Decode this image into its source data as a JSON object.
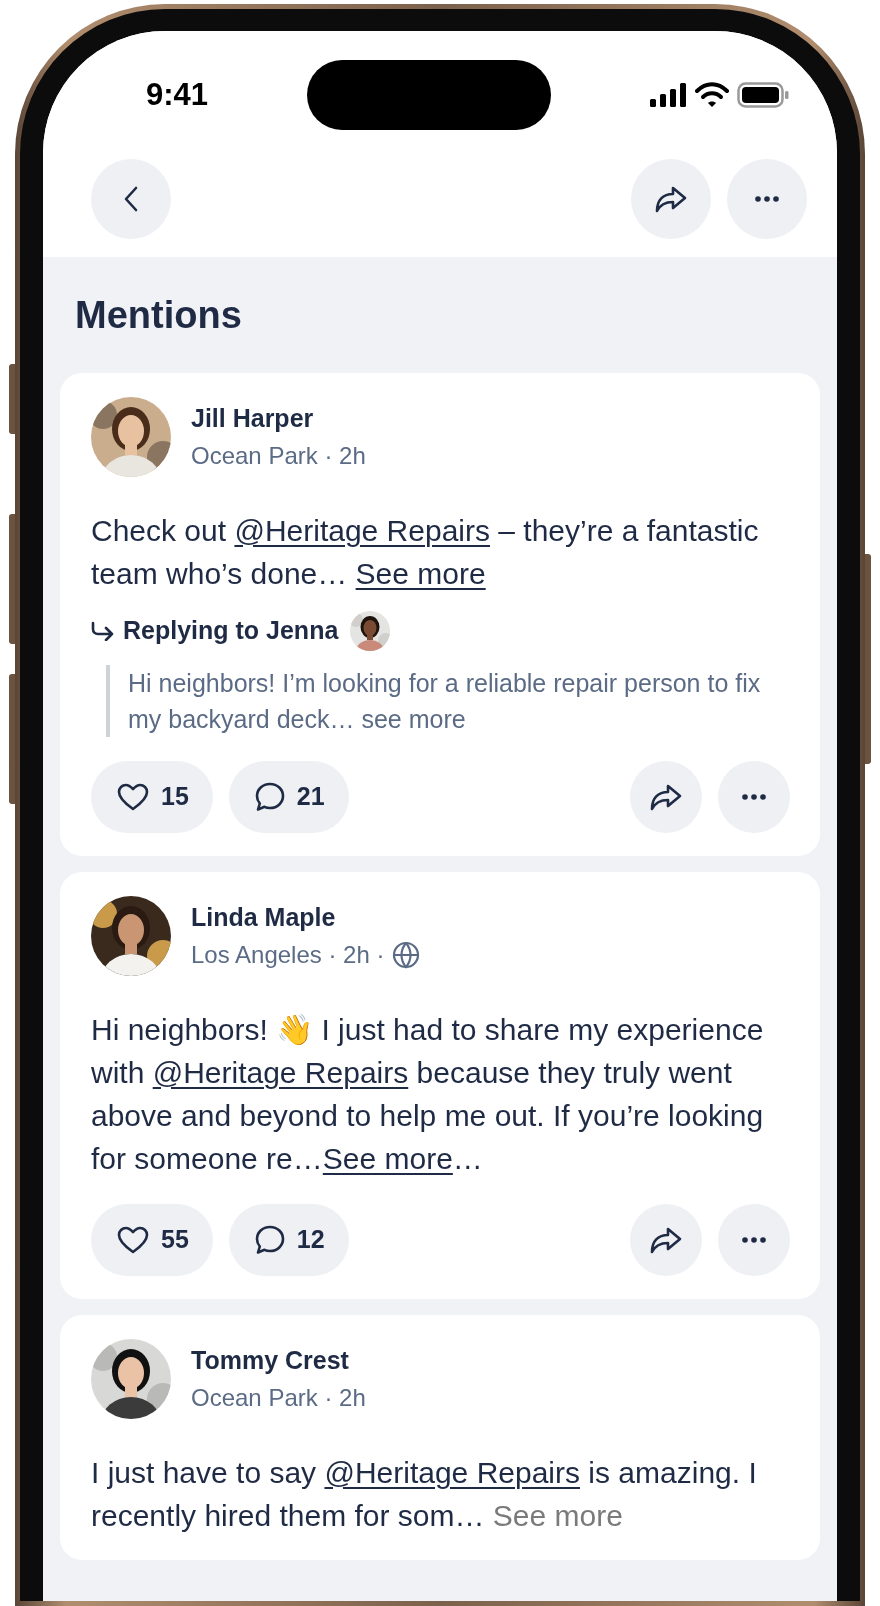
{
  "status_bar": {
    "time": "9:41"
  },
  "page": {
    "title": "Mentions"
  },
  "posts": [
    {
      "author": "Jill Harper",
      "meta": "Ocean Park · 2h",
      "public": false,
      "body": [
        {
          "kind": "text",
          "text": "Check out "
        },
        {
          "kind": "mention",
          "text": "@Heritage Repairs"
        },
        {
          "kind": "text",
          "text": " – they’re a fantastic team who’s done… "
        },
        {
          "kind": "more",
          "text": "See more"
        }
      ],
      "reply": {
        "label": "Replying to Jenna",
        "quote": "Hi neighbors! I’m looking for a reliable repair person to fix my backyard deck… see more"
      },
      "likes": "15",
      "comments": "21"
    },
    {
      "author": "Linda Maple",
      "meta": "Los Angeles · 2h ·",
      "public": true,
      "body": [
        {
          "kind": "text",
          "text": "Hi neighbors! 👋 I just had to share my experience with "
        },
        {
          "kind": "mention",
          "text": "@Heritage Repairs"
        },
        {
          "kind": "text",
          "text": " because they truly went above and beyond to help me out. If you’re looking for someone re…"
        },
        {
          "kind": "more",
          "text": "See more"
        },
        {
          "kind": "text",
          "text": "…"
        }
      ],
      "likes": "55",
      "comments": "12"
    },
    {
      "author": "Tommy Crest",
      "meta": "Ocean Park · 2h",
      "public": false,
      "body": [
        {
          "kind": "text",
          "text": "I just have to say "
        },
        {
          "kind": "mention",
          "text": "@Heritage Repairs"
        },
        {
          "kind": "text",
          "text": " is amazing. I recently hired them for som… "
        },
        {
          "kind": "muted_more",
          "text": "See more"
        }
      ]
    }
  ]
}
